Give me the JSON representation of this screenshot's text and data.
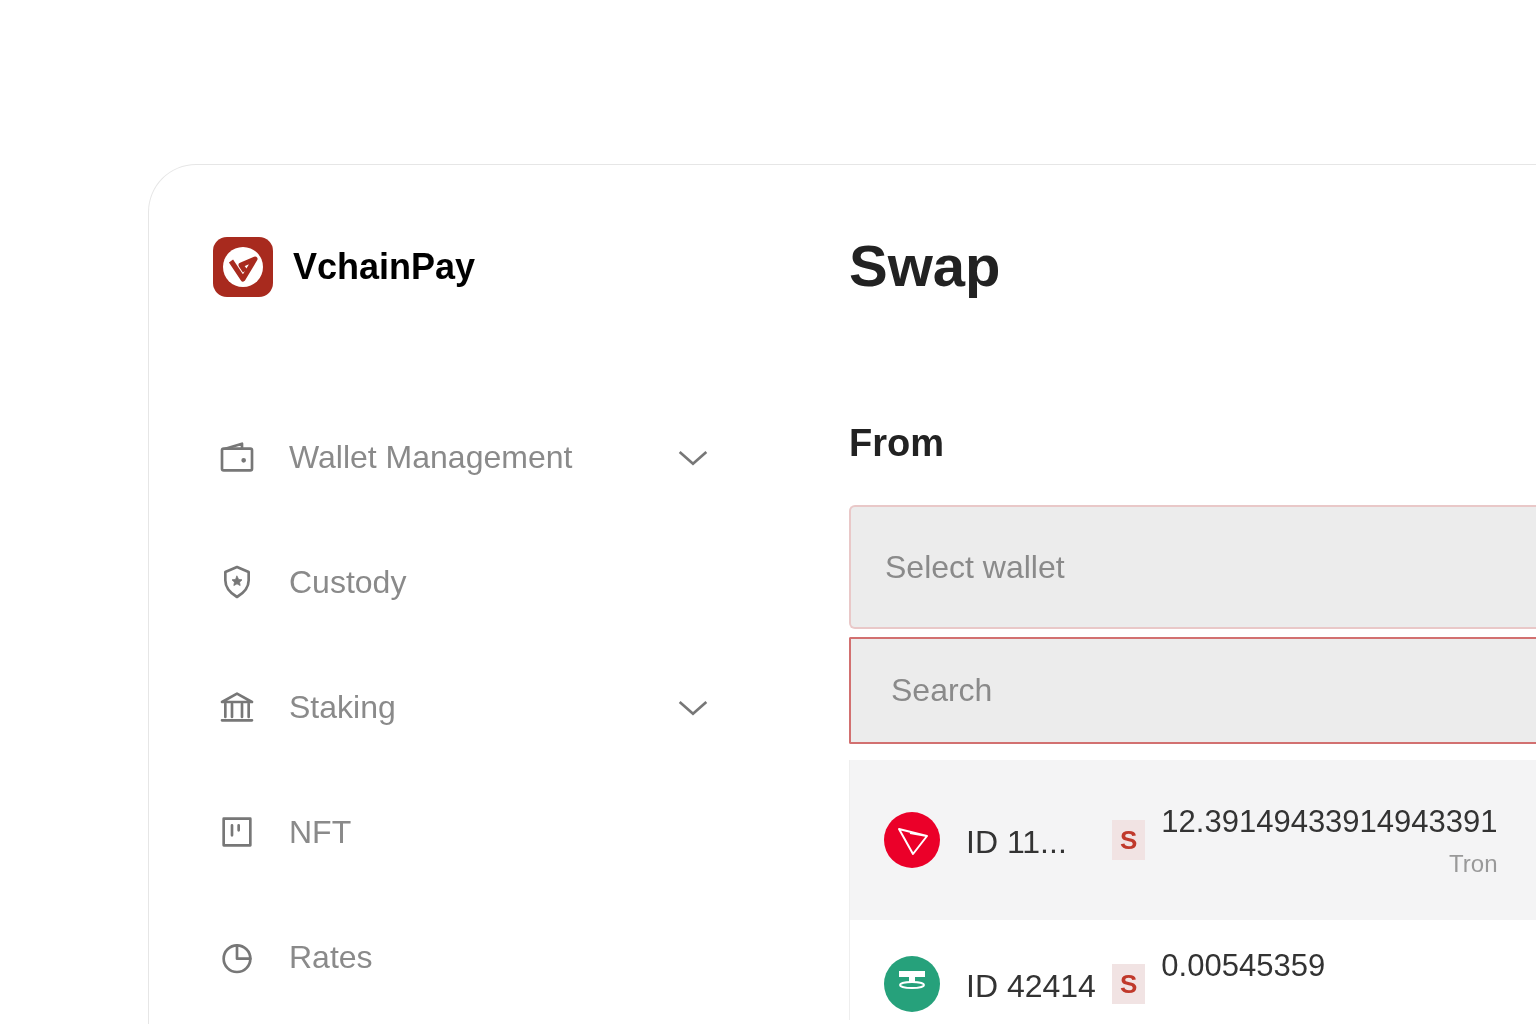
{
  "brand": {
    "name": "VchainPay"
  },
  "sidebar": {
    "items": [
      {
        "label": "Wallet Management",
        "expandable": true
      },
      {
        "label": "Custody",
        "expandable": false
      },
      {
        "label": "Staking",
        "expandable": true
      },
      {
        "label": "NFT",
        "expandable": false
      },
      {
        "label": "Rates",
        "expandable": false
      }
    ]
  },
  "page": {
    "title": "Swap"
  },
  "from": {
    "label": "From",
    "select": {
      "placeholder": "Select wallet"
    },
    "search": {
      "placeholder": "Search",
      "focused": true
    },
    "wallets": [
      {
        "id": "ID 11...",
        "badge": "S",
        "amount": "12.39149433914943391",
        "network": "Tron",
        "selected": true
      },
      {
        "id": "ID 42414",
        "badge": "S",
        "amount": "0.00545359",
        "selected": false
      }
    ]
  }
}
